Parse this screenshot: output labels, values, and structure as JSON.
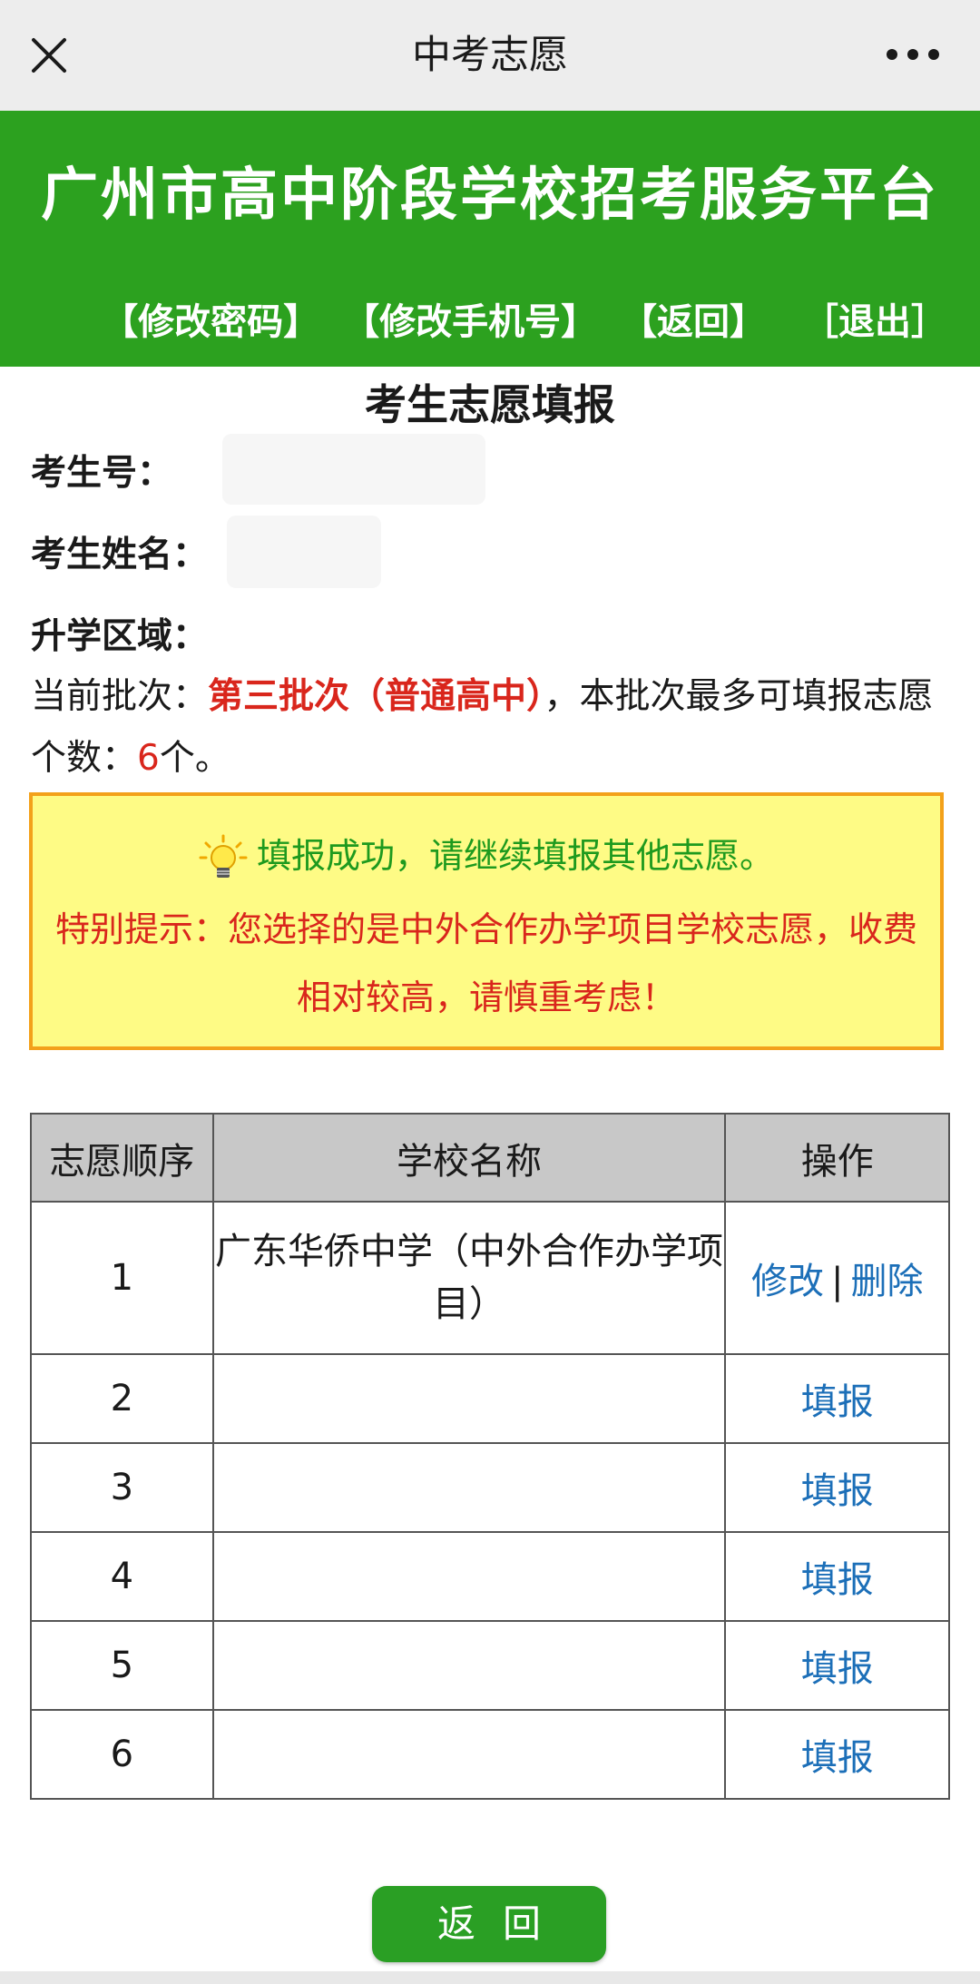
{
  "nav": {
    "title": "中考志愿"
  },
  "banner": {
    "title": "广州市高中阶段学校招考服务平台",
    "links": [
      "【修改密码】",
      "【修改手机号】",
      "【返回】",
      "［退出］"
    ]
  },
  "page_title": "考生志愿填报",
  "info": {
    "exam_no_label": "考生号：",
    "name_label": "考生姓名：",
    "region_label": "升学区域："
  },
  "batch": {
    "prefix": "当前批次：",
    "name": "第三批次（普通高中）",
    "middle": "，本批次最多可填报志愿个数：",
    "max_count": "6",
    "suffix": "个。"
  },
  "notice": {
    "success": "填报成功，请继续填报其他志愿。",
    "warning": "特别提示：您选择的是中外合作办学项目学校志愿，收费相对较高，请慎重考虑！"
  },
  "table": {
    "headers": [
      "志愿顺序",
      "学校名称",
      "操作"
    ],
    "row1": {
      "order": "1",
      "school": "广东华侨中学（中外合作办学项目）",
      "edit": "修改",
      "sep": "|",
      "delete": "删除"
    },
    "row2": {
      "order": "2",
      "action": "填报"
    },
    "row3": {
      "order": "3",
      "action": "填报"
    },
    "row4": {
      "order": "4",
      "action": "填报"
    },
    "row5": {
      "order": "5",
      "action": "填报"
    },
    "row6": {
      "order": "6",
      "action": "填报"
    }
  },
  "return_button": "返回",
  "colors": {
    "banner_green": "#2ca11f",
    "alert_red": "#d9261c",
    "link_blue": "#1c6fb8",
    "notice_yellow": "#fefb85",
    "notice_border": "#f3a11a"
  },
  "icons": [
    "close-icon",
    "more-icon",
    "lightbulb-icon"
  ]
}
